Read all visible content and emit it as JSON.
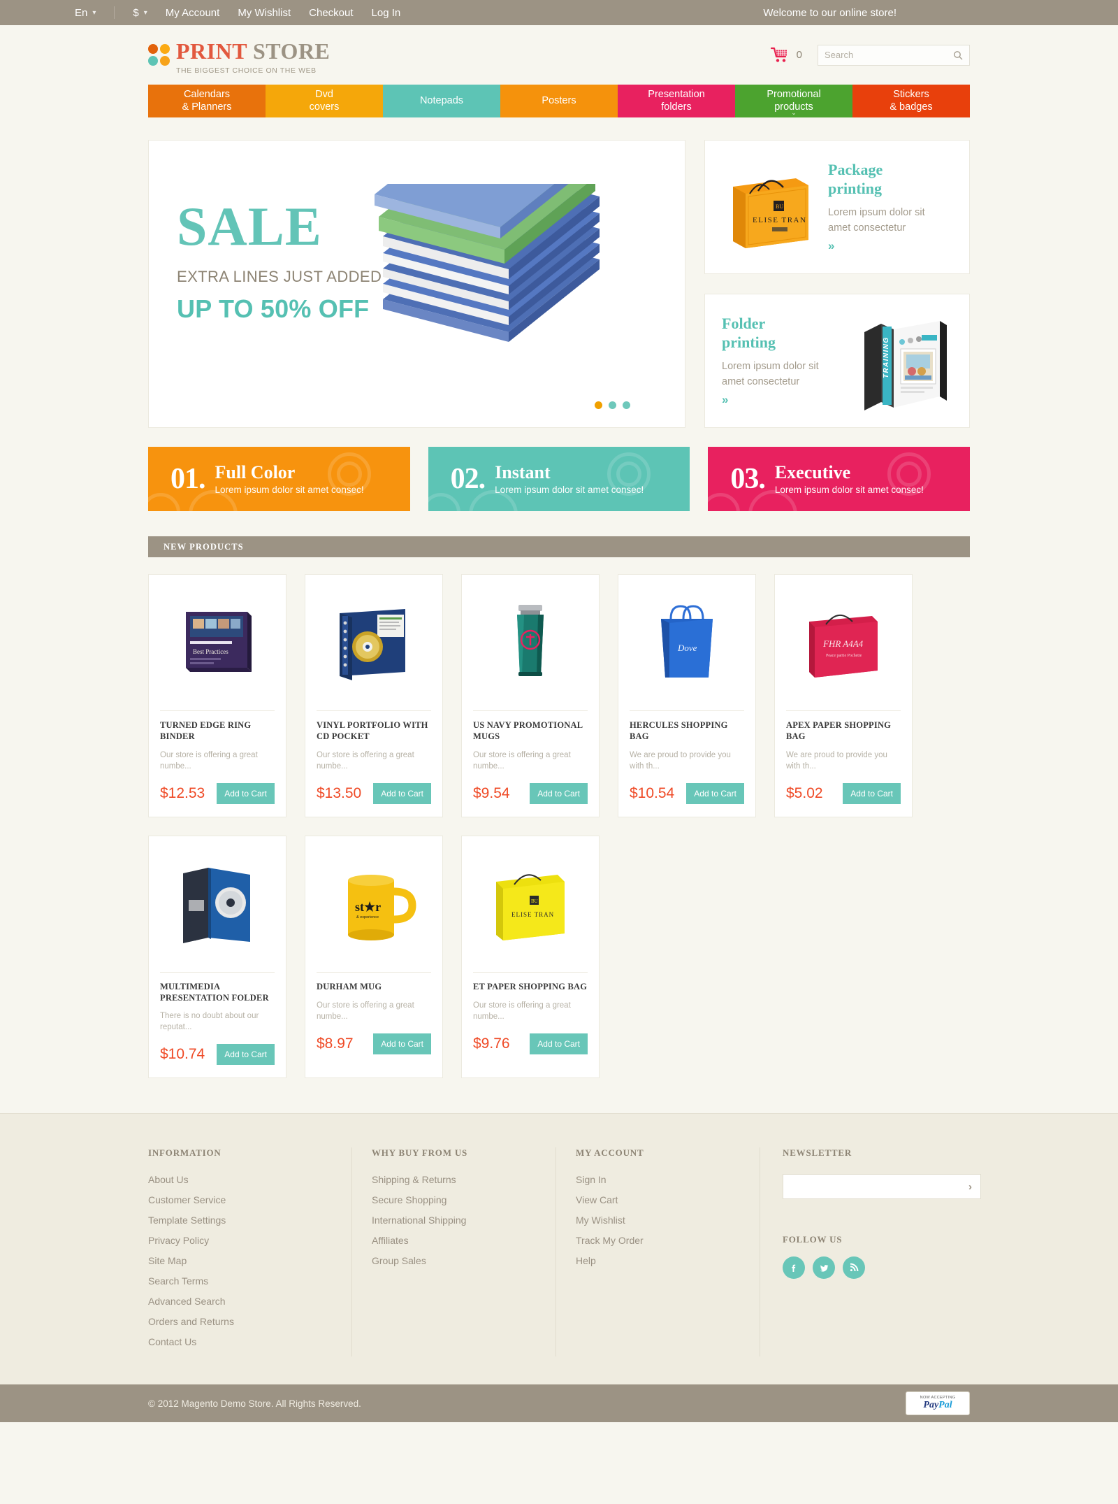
{
  "topbar": {
    "language": "En",
    "currency": "$",
    "links": [
      "My Account",
      "My Wishlist",
      "Checkout",
      "Log In"
    ],
    "welcome": "Welcome to our online store!"
  },
  "header": {
    "logo_print": "PRINT",
    "logo_store": "STORE",
    "tagline": "THE BIGGEST CHOICE ON THE WEB",
    "cart_count": "0",
    "search_placeholder": "Search",
    "search_value": ""
  },
  "nav": [
    {
      "line1": "Calendars",
      "line2": "& Planners",
      "color": "#e8720c",
      "caret": false
    },
    {
      "line1": "Dvd",
      "line2": "covers",
      "color": "#f5a70a",
      "caret": false
    },
    {
      "line1": "Notepads",
      "line2": "",
      "color": "#5dc4b5",
      "caret": false
    },
    {
      "line1": "Posters",
      "line2": "",
      "color": "#f5920c",
      "caret": false
    },
    {
      "line1": "Presentation",
      "line2": "folders",
      "color": "#e8215f",
      "caret": false
    },
    {
      "line1": "Promotional",
      "line2": "products",
      "color": "#4ca32f",
      "caret": true
    },
    {
      "line1": "Stickers",
      "line2": "& badges",
      "color": "#e8400c",
      "caret": false
    }
  ],
  "hero": {
    "sale": "SALE",
    "subtitle": "EXTRA LINES JUST ADDED",
    "offer": "UP TO 50% OFF",
    "dots": 3,
    "active_dot": 0
  },
  "promos": [
    {
      "title_line1": "Package",
      "title_line2": "printing",
      "desc_line1": "Lorem ipsum dolor sit",
      "desc_line2": "amet consectetur",
      "more": "»",
      "image_side": "left",
      "image_name": "orange-shopping-bag-image",
      "bag_text": "ELISE TRAN"
    },
    {
      "title_line1": "Folder",
      "title_line2": "printing",
      "desc_line1": "Lorem ipsum dolor sit",
      "desc_line2": "amet consectetur",
      "more": "»",
      "image_side": "right",
      "image_name": "black-training-binder-image",
      "binder_text": "TRAINING"
    }
  ],
  "features": [
    {
      "num": "01.",
      "title": "Full Color",
      "desc": "Lorem ipsum dolor sit amet consec!",
      "color": "#f7930e"
    },
    {
      "num": "02.",
      "title": "Instant",
      "desc": "Lorem ipsum dolor sit amet consec!",
      "color": "#5dc4b5"
    },
    {
      "num": "03.",
      "title": "Executive",
      "desc": "Lorem ipsum dolor sit amet consec!",
      "color": "#e8215f"
    }
  ],
  "new_products": {
    "section_title": "NEW PRODUCTS",
    "add_to_cart_label": "Add to Cart",
    "items": [
      {
        "title": "TURNED EDGE RING BINDER",
        "desc": "Our store is offering a great numbe...",
        "price": "$12.53",
        "image_name": "turned-edge-ring-binder-image"
      },
      {
        "title": "VINYL PORTFOLIO WITH CD POCKET",
        "desc": "Our store is offering a great numbe...",
        "price": "$13.50",
        "image_name": "vinyl-portfolio-cd-pocket-image"
      },
      {
        "title": "US NAVY PROMOTIONAL MUGS",
        "desc": "Our store is offering a great numbe...",
        "price": "$9.54",
        "image_name": "us-navy-promotional-mug-image"
      },
      {
        "title": "HERCULES SHOPPING BAG",
        "desc": "We are proud to provide you with th...",
        "price": "$10.54",
        "image_name": "hercules-shopping-bag-image"
      },
      {
        "title": "APEX PAPER SHOPPING BAG",
        "desc": "We are proud to provide you with th...",
        "price": "$5.02",
        "image_name": "apex-paper-shopping-bag-image"
      },
      {
        "title": "MULTIMEDIA PRESENTATION FOLDER",
        "desc": "There is no doubt about our reputat...",
        "price": "$10.74",
        "image_name": "multimedia-presentation-folder-image"
      },
      {
        "title": "DURHAM MUG",
        "desc": "Our store is offering a great numbe...",
        "price": "$8.97",
        "image_name": "durham-mug-image"
      },
      {
        "title": "ET PAPER SHOPPING BAG",
        "desc": "Our store is offering a great numbe...",
        "price": "$9.76",
        "image_name": "et-paper-shopping-bag-image"
      }
    ]
  },
  "footer": {
    "col1": {
      "heading": "INFORMATION",
      "links": [
        "About Us",
        "Customer Service",
        "Template Settings",
        "Privacy Policy",
        "Site Map",
        "Search Terms",
        "Advanced Search",
        "Orders and Returns",
        "Contact Us"
      ]
    },
    "col2": {
      "heading": "WHY BUY FROM US",
      "links": [
        "Shipping & Returns",
        "Secure Shopping",
        "International Shipping",
        "Affiliates",
        "Group Sales"
      ]
    },
    "col3": {
      "heading": "MY ACCOUNT",
      "links": [
        "Sign In",
        "View Cart",
        "My Wishlist",
        "Track My Order",
        "Help"
      ]
    },
    "col4": {
      "newsletter_heading": "NEWSLETTER",
      "newsletter_value": "",
      "newsletter_placeholder": "",
      "submit_icon": "›",
      "follow_heading": "FOLLOW US",
      "socials": [
        "facebook-icon",
        "twitter-icon",
        "rss-icon"
      ]
    }
  },
  "bottombar": {
    "copyright": "© 2012 Magento Demo Store. All Rights Reserved.",
    "paypal_top": "NOW ACCEPTING",
    "paypal_pay": "Pay",
    "paypal_pal": "Pal"
  },
  "colors": {
    "teal": "#5dc4b5",
    "orange": "#e8720c",
    "red_price": "#ef4a26",
    "taupe": "#9c9384",
    "bg": "#f7f6ef"
  }
}
